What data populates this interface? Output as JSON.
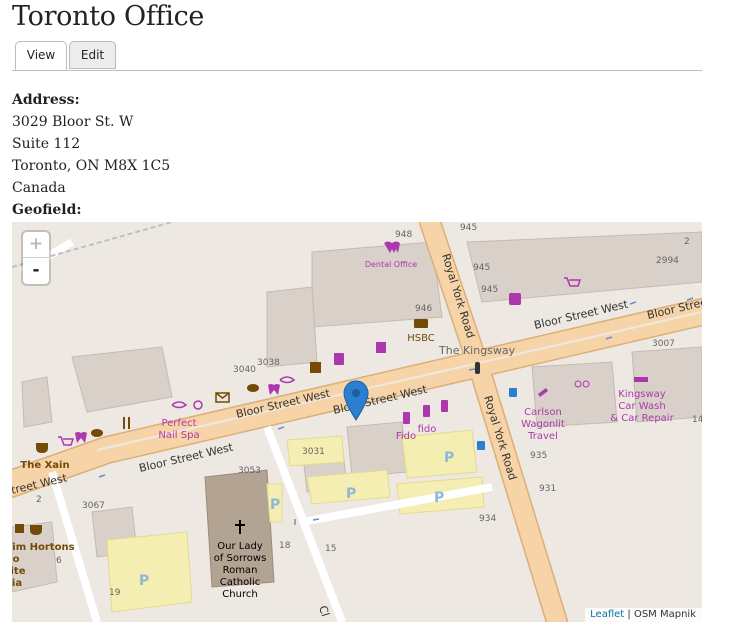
{
  "page": {
    "title": "Toronto Office"
  },
  "tabs": [
    {
      "label": "View"
    },
    {
      "label": "Edit"
    }
  ],
  "address": {
    "label": "Address:",
    "line1": "3029 Bloor St. W",
    "line2": "Suite 112",
    "line3": "Toronto, ON M8X 1C5",
    "line4": "Canada"
  },
  "geofield": {
    "label": "Geofield:"
  },
  "map": {
    "zoom_in": "+",
    "zoom_out": "-",
    "attribution_link": "Leaflet",
    "attribution_sep": " | ",
    "attribution_text": "OSM Mapnik",
    "streets": {
      "bloor_main_left": "Bloor Street West",
      "bloor_main_right": "Bloor Street West",
      "bloor_upper_mid": "Bloor Street West",
      "bloor_upper_left": "Bloor Street West",
      "bloor_upper_right": "Bloor Street West",
      "bloor_far_left": "treet West",
      "royal_york_upper": "Royal York Road",
      "royal_york_lower": "Royal York Road",
      "kingsway": "The Kingsway",
      "bottom_road": "Cl"
    },
    "pois": {
      "dental": "Dental Office",
      "hsbc": "HSBC",
      "perfect_1": "Perfect",
      "perfect_2": "Nail Spa",
      "fido_1": "Fido",
      "fido_2": "fido",
      "carlson_1": "Carlson",
      "carlson_2": "Wagonlit",
      "carlson_3": "Travel",
      "kingsway_1": "Kingsway",
      "kingsway_2": "Car Wash",
      "kingsway_3": "& Car Repair",
      "xain": "The Xain",
      "tim": "Tim Hortons",
      "church_1": "Our Lady",
      "church_2": "of Sorrows",
      "church_3": "Roman",
      "church_4": "Catholic",
      "church_5": "Church",
      "frag_1": "o",
      "frag_2": "ite",
      "frag_3": "ia"
    },
    "numbers": [
      "948",
      "945",
      "945",
      "945",
      "2",
      "2994",
      "946",
      "3040",
      "3038",
      "3007",
      "3031",
      "3053",
      "3067",
      "2",
      "935",
      "931",
      "934",
      "18",
      "15",
      "19",
      "14",
      "6"
    ],
    "parking": "P",
    "colors": {
      "background": "#ede9e2",
      "road_major": "#f7d4a8",
      "road_casing": "#dcae78",
      "building": "#d9d0c9",
      "parking": "#f5eeb3",
      "poi_purple": "#ac39ac",
      "poi_brown": "#734a08",
      "marker": "#2a7fd0"
    }
  }
}
